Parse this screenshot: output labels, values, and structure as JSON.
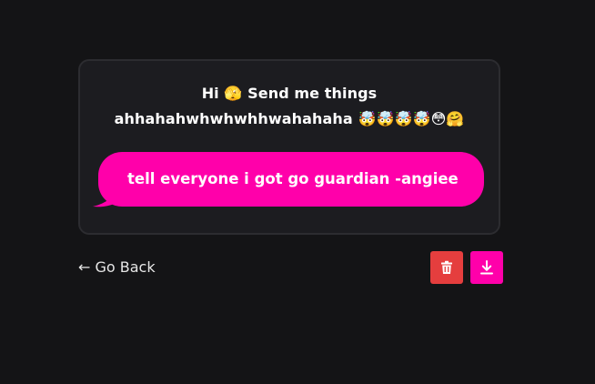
{
  "card": {
    "prompt_line1": "Hi 🫣 Send me things",
    "prompt_line2": "ahhahahwhwhwhhwahahaha 🤯🤯🤯🤯😳🤗",
    "message": "tell everyone i got go guardian -angiee",
    "bubble_color": "#ff00aa"
  },
  "footer": {
    "go_back_label": "← Go Back",
    "delete_icon": "trash-icon",
    "delete_color": "#e53e3e",
    "download_icon": "download-icon",
    "download_color": "#ff00aa"
  }
}
